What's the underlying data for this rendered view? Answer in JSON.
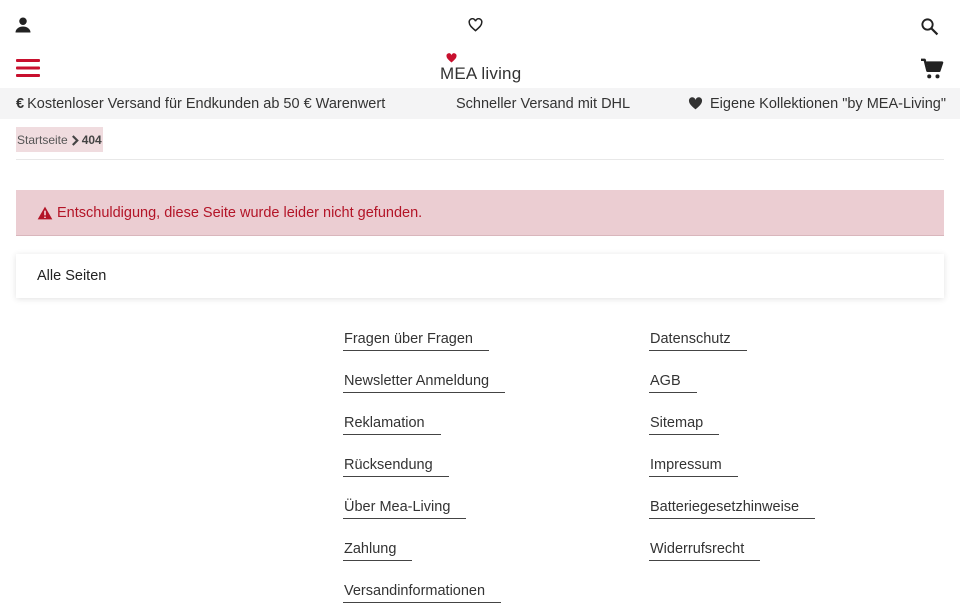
{
  "header": {
    "logo_text": "MEA living",
    "icons": {
      "account": "user-icon",
      "wishlist": "heart-outline-icon",
      "search": "search-icon",
      "menu": "hamburger-menu-icon",
      "cart": "shopping-cart-icon"
    }
  },
  "usp": {
    "shipping_free": "Kostenloser Versand für Endkunden ab 50 € Warenwert",
    "shipping_fast": "Schneller Versand mit DHL",
    "collections": "Eigene Kollektionen \"by MEA-Living\""
  },
  "breadcrumb": {
    "home": "Startseite",
    "current": "404"
  },
  "alert": {
    "message": "Entschuldigung, diese Seite wurde leider nicht gefunden."
  },
  "panel": {
    "title": "Alle Seiten"
  },
  "links": {
    "left": [
      "Fragen über Fragen",
      "Newsletter Anmeldung",
      "Reklamation",
      "Rücksendung",
      "Über Mea-Living",
      "Zahlung",
      "Versandinformationen"
    ],
    "right": [
      "Datenschutz",
      "AGB",
      "Sitemap",
      "Impressum",
      "Batteriegesetzhinweise",
      "Widerrufsrecht"
    ]
  },
  "colors": {
    "brand_red": "#c8102e",
    "alert_bg": "#ebcdd2",
    "alert_text": "#b31427",
    "breadcrumb_bg": "#f0dcdf",
    "usp_bg": "#f4f4f5"
  }
}
